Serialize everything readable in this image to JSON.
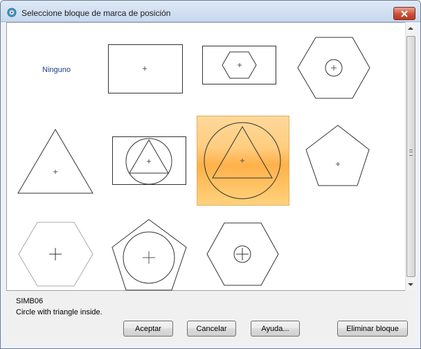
{
  "window": {
    "title": "Seleccione bloque de marca de posición"
  },
  "grid": {
    "none_label": "Ninguno",
    "items": [
      {
        "name": "ninguno",
        "desc": "Ninguno"
      },
      {
        "name": "rectangle-plus",
        "desc": "Rectangle with cross"
      },
      {
        "name": "rectangle-hexagon",
        "desc": "Rectangle with hexagon"
      },
      {
        "name": "hexagon-circle",
        "desc": "Hexagon with circle"
      },
      {
        "name": "triangle",
        "desc": "Triangle"
      },
      {
        "name": "rectangle-circle-triangle",
        "desc": "Rectangle with circle and triangle"
      },
      {
        "name": "circle-triangle",
        "desc": "Circle with triangle inside"
      },
      {
        "name": "pentagon",
        "desc": "Pentagon"
      },
      {
        "name": "hexagon-cross",
        "desc": "Hexagon with cross"
      },
      {
        "name": "pentagon-circle",
        "desc": "Pentagon with circle"
      },
      {
        "name": "hexagon-small-circle",
        "desc": "Hexagon with small circle"
      }
    ],
    "selected_index": 6
  },
  "info": {
    "name": "SIMB06",
    "description": "Circle with triangle inside."
  },
  "buttons": {
    "accept": "Aceptar",
    "cancel": "Cancelar",
    "help": "Ayuda...",
    "delete": "Eliminar bloque"
  },
  "colors": {
    "selection": "#ffbf60",
    "link_text": "#1f3f86",
    "close_button": "#cb4a34"
  },
  "icons": {
    "app": "target-icon",
    "close": "close-icon",
    "scroll_up": "chevron-up-icon",
    "scroll_down": "chevron-down-icon"
  }
}
